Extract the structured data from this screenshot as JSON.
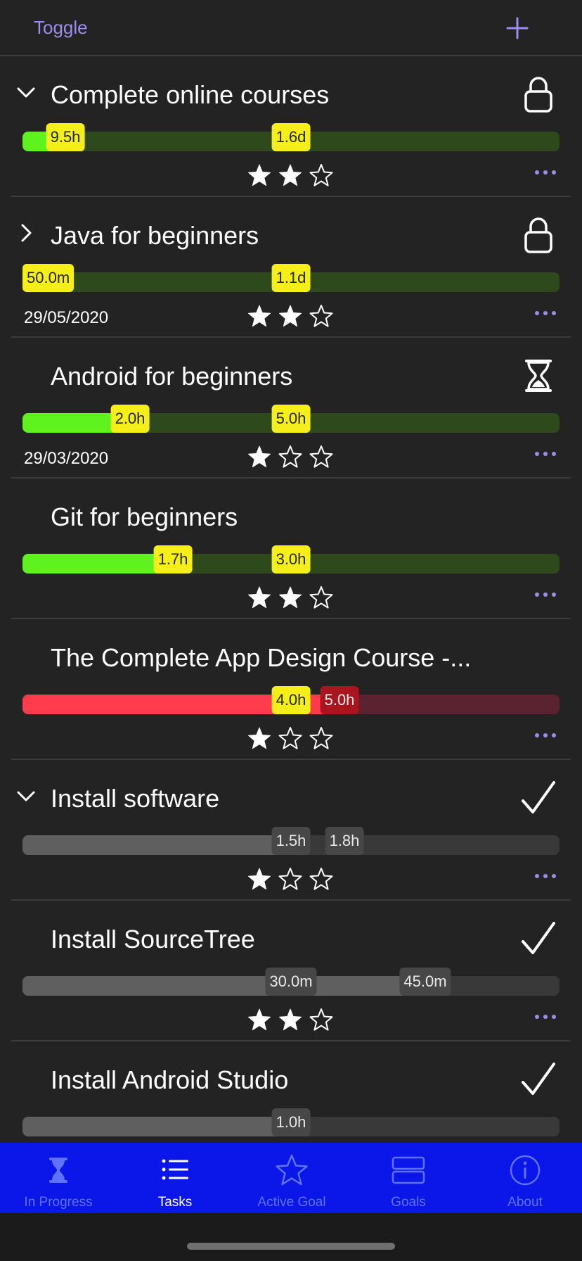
{
  "header": {
    "toggle_label": "Toggle",
    "add_icon": "plus-icon"
  },
  "colors": {
    "background": "#232323",
    "accent": "#9d8cf0",
    "progress_green": "#5ef31f",
    "track_green": "#2e4a1c",
    "progress_red": "#ff3b4e",
    "track_red": "#5b2230",
    "progress_grey": "#5f5f5f",
    "track_grey": "#393939",
    "badge_yellow": "#f5ee17",
    "badge_darkred": "#a8151f",
    "tab_bar": "#0a17e8"
  },
  "tasks": [
    {
      "title": "Complete online courses",
      "chevron": "down",
      "status_icon": "lock-icon",
      "color": "green",
      "progress": 0.08,
      "elapsed": "9.5h",
      "elapsed_at": 0.08,
      "target": "1.6d",
      "target_at": 0.5,
      "date": "",
      "stars": 2
    },
    {
      "title": "Java for beginners",
      "chevron": "right",
      "status_icon": "lock-icon",
      "color": "green",
      "progress": 0.0,
      "elapsed": "50.0m",
      "elapsed_at": 0.0,
      "target": "1.1d",
      "target_at": 0.5,
      "date": "29/05/2020",
      "stars": 2
    },
    {
      "title": "Android for beginners",
      "chevron": "",
      "status_icon": "hourglass-icon",
      "color": "green",
      "progress": 0.2,
      "elapsed": "2.0h",
      "elapsed_at": 0.2,
      "target": "5.0h",
      "target_at": 0.5,
      "date": "29/03/2020",
      "stars": 1
    },
    {
      "title": "Git for beginners",
      "chevron": "",
      "status_icon": "",
      "color": "green",
      "progress": 0.28,
      "elapsed": "1.7h",
      "elapsed_at": 0.28,
      "target": "3.0h",
      "target_at": 0.5,
      "date": "",
      "stars": 2
    },
    {
      "title": "The Complete App Design Course -...",
      "chevron": "",
      "status_icon": "",
      "color": "red",
      "progress": 0.59,
      "elapsed": "5.0h",
      "elapsed_at": 0.59,
      "target": "4.0h",
      "target_at": 0.5,
      "date": "",
      "stars": 1
    },
    {
      "title": "Install software",
      "chevron": "down",
      "status_icon": "checkmark-icon",
      "color": "grey",
      "progress": 0.5,
      "elapsed": "1.8h",
      "elapsed_at": 0.6,
      "target": "1.5h",
      "target_at": 0.5,
      "date": "",
      "stars": 1
    },
    {
      "title": "Install SourceTree",
      "chevron": "",
      "status_icon": "checkmark-icon",
      "color": "grey",
      "progress": 0.75,
      "elapsed": "45.0m",
      "elapsed_at": 0.75,
      "target": "30.0m",
      "target_at": 0.5,
      "date": "",
      "stars": 2
    },
    {
      "title": "Install Android Studio",
      "chevron": "",
      "status_icon": "checkmark-icon",
      "color": "grey",
      "progress": 0.5,
      "elapsed": "",
      "elapsed_at": 0.5,
      "target": "1.0h",
      "target_at": 0.5,
      "date": "",
      "stars": 0
    }
  ],
  "tabs": [
    {
      "label": "In Progress",
      "icon": "hourglass-icon",
      "active": false
    },
    {
      "label": "Tasks",
      "icon": "list-icon",
      "active": true
    },
    {
      "label": "Active Goal",
      "icon": "star-icon",
      "active": false
    },
    {
      "label": "Goals",
      "icon": "goals-icon",
      "active": false
    },
    {
      "label": "About",
      "icon": "info-icon",
      "active": false
    }
  ]
}
